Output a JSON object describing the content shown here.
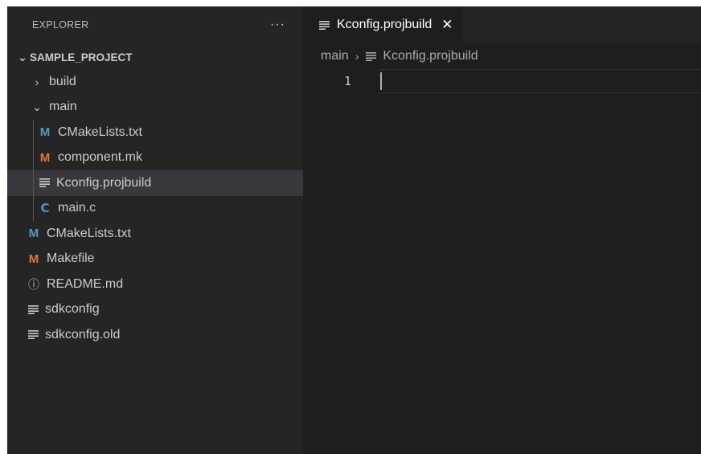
{
  "sidebar": {
    "title": "EXPLORER",
    "more_label": "···",
    "project": {
      "chevron": "⌄",
      "name": "SAMPLE_PROJECT"
    },
    "items": [
      {
        "label": "build",
        "chevron": "›",
        "icon": "chevron-right-icon"
      },
      {
        "label": "main",
        "chevron": "⌄",
        "icon": "chevron-down-icon"
      },
      {
        "label": "CMakeLists.txt",
        "icon_glyph": "M",
        "icon": "cmake-file-icon"
      },
      {
        "label": "component.mk",
        "icon_glyph": "M",
        "icon": "makefile-icon"
      },
      {
        "label": "Kconfig.projbuild",
        "icon": "text-lines-icon",
        "selected": true
      },
      {
        "label": "main.c",
        "icon_glyph": "C",
        "icon": "c-file-icon"
      },
      {
        "label": "CMakeLists.txt",
        "icon_glyph": "M",
        "icon": "cmake-file-icon"
      },
      {
        "label": "Makefile",
        "icon_glyph": "M",
        "icon": "makefile-icon"
      },
      {
        "label": "README.md",
        "icon_glyph": "ⓘ",
        "icon": "info-icon"
      },
      {
        "label": "sdkconfig",
        "icon": "text-lines-icon"
      },
      {
        "label": "sdkconfig.old",
        "icon": "text-lines-icon"
      }
    ]
  },
  "editor": {
    "tab": {
      "label": "Kconfig.projbuild",
      "close": "✕"
    },
    "breadcrumb": {
      "folder": "main",
      "separator": "›",
      "file": "Kconfig.projbuild"
    },
    "lines": [
      {
        "number": "1",
        "text": ""
      }
    ]
  },
  "colors": {
    "sidebar_bg": "#252526",
    "editor_bg": "#1e1e1e",
    "selected_bg": "#37373d",
    "cmake_icon": "#519aba",
    "make_icon": "#e37933"
  }
}
